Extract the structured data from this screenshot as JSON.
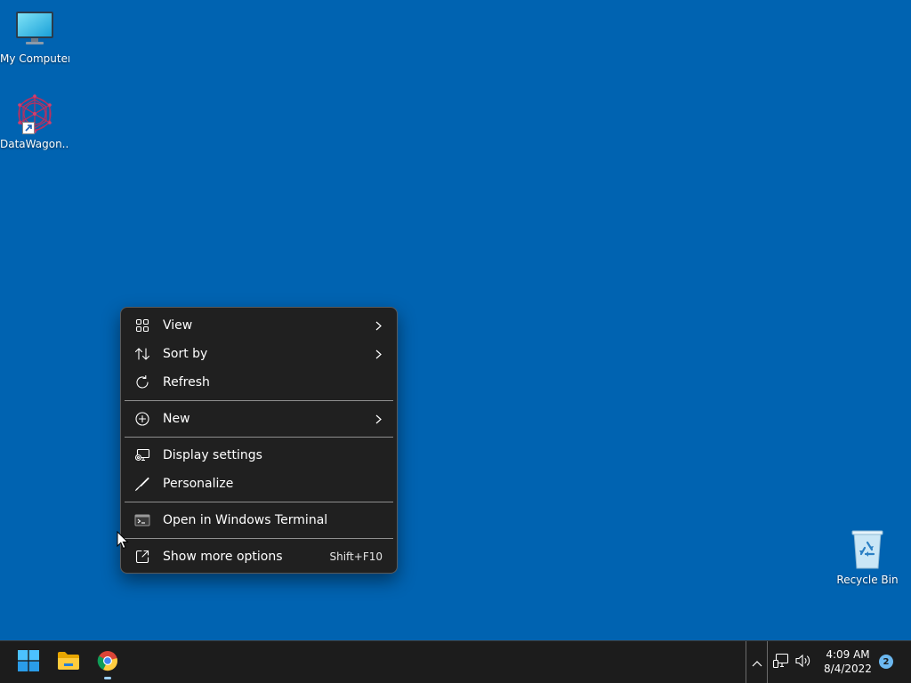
{
  "desktop": {
    "background_color": "#0063b1",
    "icons": [
      {
        "label": "My Computer",
        "icon": "monitor-icon"
      },
      {
        "label": "DataWagon...",
        "icon": "datawagon-logo-icon",
        "shortcut": true
      },
      {
        "label": "Recycle Bin",
        "icon": "recycle-bin-icon"
      }
    ]
  },
  "context_menu": {
    "items": [
      {
        "label": "View",
        "icon": "grid-icon",
        "submenu": true
      },
      {
        "label": "Sort by",
        "icon": "sort-icon",
        "submenu": true
      },
      {
        "label": "Refresh",
        "icon": "refresh-icon"
      },
      {
        "label": "New",
        "icon": "plus-circle-icon",
        "submenu": true
      },
      {
        "label": "Display settings",
        "icon": "display-settings-icon"
      },
      {
        "label": "Personalize",
        "icon": "brush-icon"
      },
      {
        "label": "Open in Windows Terminal",
        "icon": "terminal-icon"
      },
      {
        "label": "Show more options",
        "icon": "expand-icon",
        "shortcut": "Shift+F10"
      }
    ]
  },
  "taskbar": {
    "apps": [
      {
        "name": "Start",
        "icon": "windows-start-icon"
      },
      {
        "name": "File Explorer",
        "icon": "folder-icon"
      },
      {
        "name": "Google Chrome",
        "icon": "chrome-icon",
        "running": true
      }
    ],
    "tray": {
      "overflow_icon": "chevron-up-icon",
      "network_icon": "network-icon",
      "volume_icon": "volume-icon"
    },
    "clock": {
      "time": "4:09 AM",
      "date": "8/4/2022"
    },
    "notifications": "2"
  }
}
